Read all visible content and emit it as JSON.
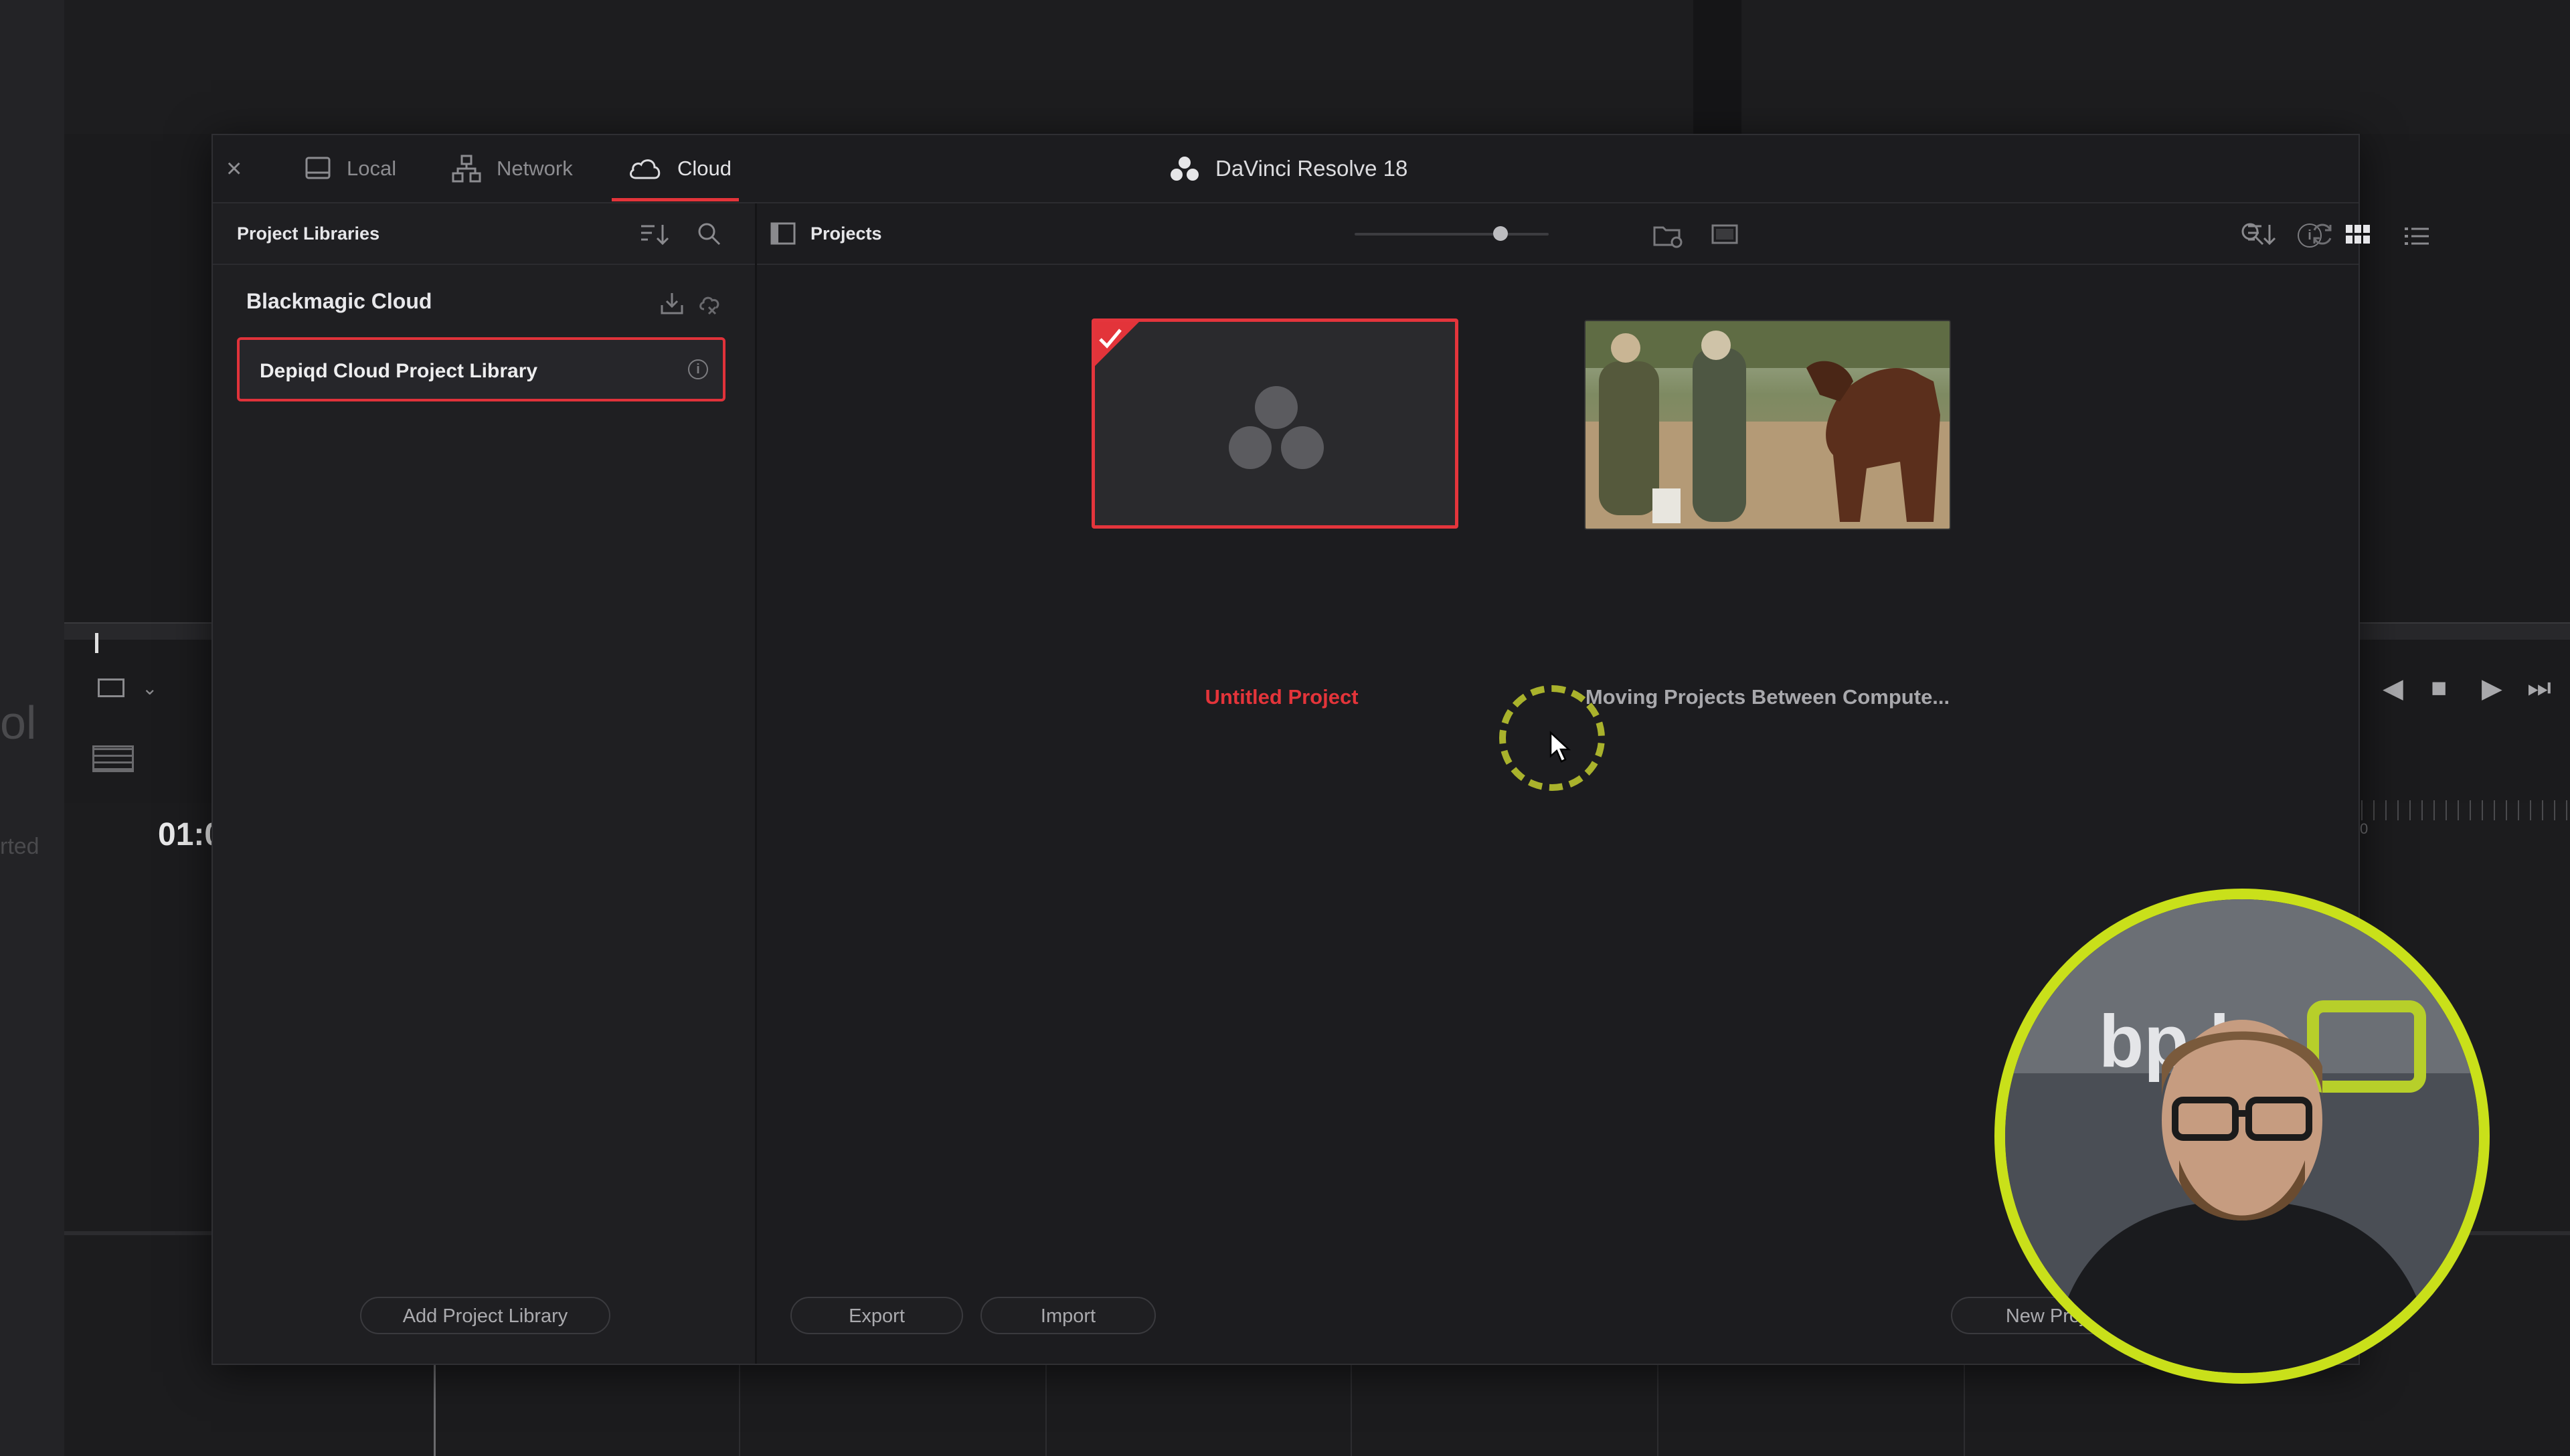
{
  "background": {
    "ghost_text_1": "ol",
    "ghost_text_2": "rted",
    "timecode": "01:0",
    "ruler_label": "0"
  },
  "dialog": {
    "close_glyph": "×",
    "tabs": [
      {
        "label": "Local",
        "icon": "drive-icon"
      },
      {
        "label": "Network",
        "icon": "network-icon"
      },
      {
        "label": "Cloud",
        "icon": "cloud-icon"
      }
    ],
    "active_tab": "Cloud",
    "app_title": "DaVinci Resolve 18",
    "left": {
      "header": "Project Libraries",
      "section": "Blackmagic Cloud",
      "selected_library": "Depiqd Cloud Project Library",
      "add_button": "Add Project Library"
    },
    "right": {
      "header": "Projects",
      "projects": [
        {
          "name": "Untitled Project",
          "selected": true
        },
        {
          "name": "Moving Projects Between Compute..."
        }
      ],
      "export_button": "Export",
      "import_button": "Import",
      "new_project_button": "New Project"
    }
  },
  "colors": {
    "accent_red": "#e3343a",
    "webcam_ring": "#c9e01a",
    "cursor_ring": "#a9b22c"
  }
}
